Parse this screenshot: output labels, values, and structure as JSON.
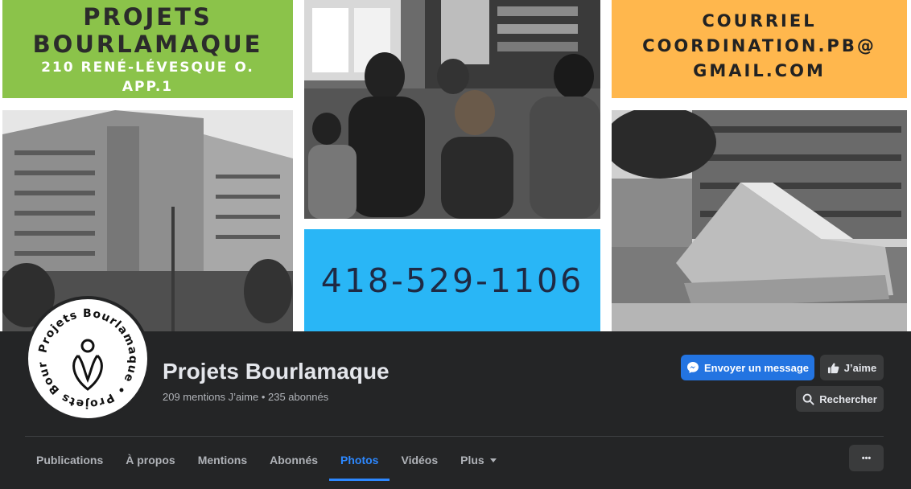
{
  "cover": {
    "green_tile": {
      "line1": "PROJETS",
      "line2": "BOURLAMAQUE",
      "line3": "210 RENÉ-LÉVESQUE O.",
      "line4": "APP.1"
    },
    "orange_tile": {
      "line1": "COURRIEL",
      "line2": "COORDINATION.PB@",
      "line3": "GMAIL.COM"
    },
    "blue_tile": {
      "phone": "418-529-1106"
    }
  },
  "page": {
    "title": "Projets Bourlamaque",
    "stats": "209 mentions J’aime • 235 abonnés",
    "avatar_text": "Projets Bourlamaque • Projets Bourlamaque"
  },
  "actions": {
    "message_label": "Envoyer un message",
    "like_label": "J’aime",
    "search_label": "Rechercher",
    "more_label": "•••"
  },
  "tabs": [
    {
      "label": "Publications"
    },
    {
      "label": "À propos"
    },
    {
      "label": "Mentions"
    },
    {
      "label": "Abonnés"
    },
    {
      "label": "Photos",
      "active": true
    },
    {
      "label": "Vidéos"
    },
    {
      "label": "Plus"
    }
  ],
  "colors": {
    "background": "#18191a",
    "header": "#242526",
    "accent": "#2d88ff",
    "message_button": "#2374e1",
    "green_tile": "#8bc34a",
    "orange_tile": "#ffb74d",
    "blue_tile": "#29b6f6"
  },
  "icons": {
    "message": "messenger-icon",
    "like": "thumbs-up-icon",
    "search": "search-icon",
    "more": "more-dots-icon",
    "dropdown": "caret-down-icon"
  }
}
